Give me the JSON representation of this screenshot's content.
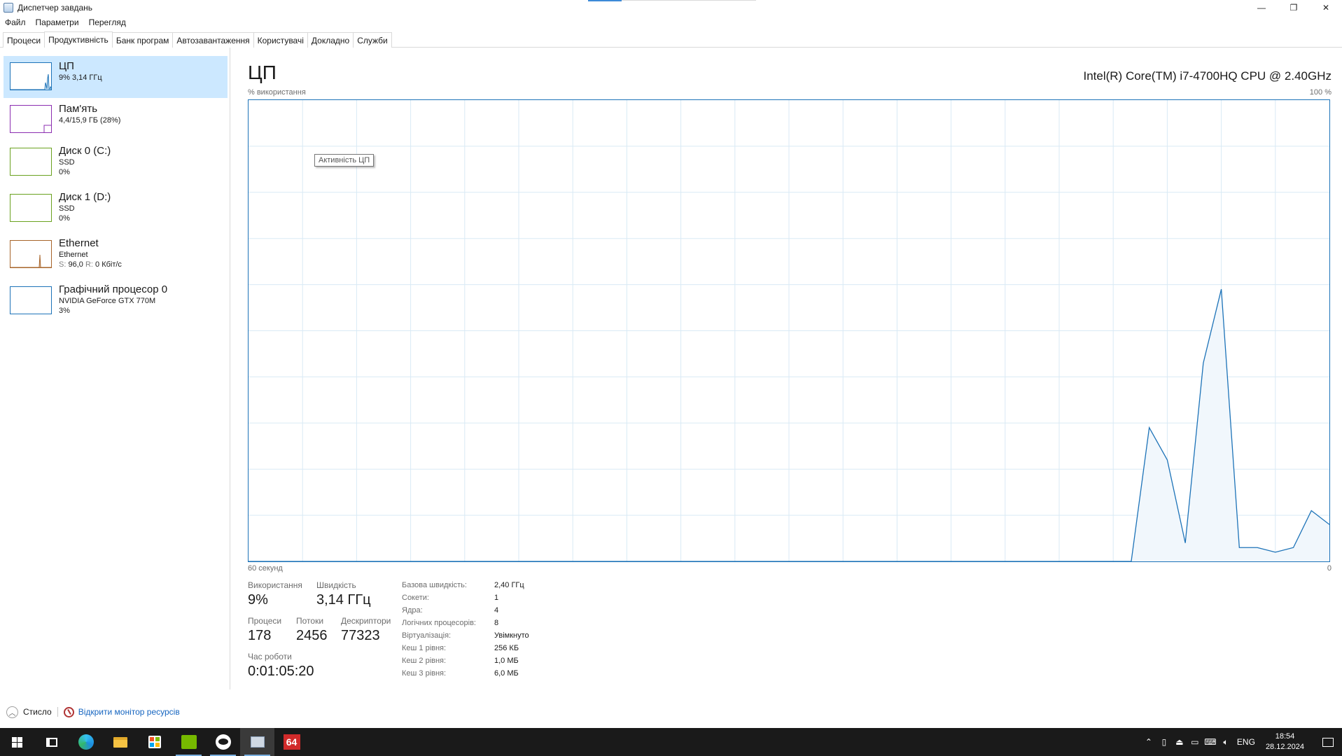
{
  "window": {
    "title": "Диспетчер завдань",
    "controls": {
      "minimize": "—",
      "restore": "❐",
      "close": "✕"
    }
  },
  "menu": [
    "Файл",
    "Параметри",
    "Перегляд"
  ],
  "tabs": [
    {
      "label": "Процеси",
      "active": false
    },
    {
      "label": "Продуктивність",
      "active": true
    },
    {
      "label": "Банк програм",
      "active": false
    },
    {
      "label": "Автозавантаження",
      "active": false
    },
    {
      "label": "Користувачі",
      "active": false
    },
    {
      "label": "Докладно",
      "active": false
    },
    {
      "label": "Служби",
      "active": false
    }
  ],
  "sidebar": {
    "cpu": {
      "name": "ЦП",
      "line1": "9% 3,14 ГГц"
    },
    "memory": {
      "name": "Пам'ять",
      "line1": "4,4/15,9 ГБ (28%)"
    },
    "disk0": {
      "name": "Диск 0 (C:)",
      "line1": "SSD",
      "line2": "0%"
    },
    "disk1": {
      "name": "Диск 1 (D:)",
      "line1": "SSD",
      "line2": "0%"
    },
    "ethernet": {
      "name": "Ethernet",
      "line1": "Ethernet",
      "send_label": "S:",
      "send_value": "96,0",
      "recv_label": "R:",
      "recv_value": "0 Кбіт/с"
    },
    "gpu": {
      "name": "Графічний процесор 0",
      "line1": "NVIDIA GeForce GTX 770M",
      "line2": "3%"
    }
  },
  "main": {
    "title": "ЦП",
    "cpu_model": "Intel(R) Core(TM) i7-4700HQ CPU @ 2.40GHz",
    "y_label": "% використання",
    "y_max_label": "100 %",
    "x_left_label": "60 секунд",
    "x_right_label": "0",
    "tooltip": "Активність ЦП"
  },
  "chart_data": {
    "type": "area",
    "xlabel": "60 секунд",
    "ylabel": "% використання",
    "ylim": [
      0,
      100
    ],
    "xlim": [
      60,
      0
    ],
    "grid": true,
    "color": "#1d73b8",
    "x": [
      60,
      11,
      10,
      9,
      8,
      7,
      6,
      5,
      4,
      3,
      2,
      1,
      0
    ],
    "values": [
      0,
      0,
      29,
      22,
      4,
      43,
      59,
      3,
      3,
      2,
      3,
      11,
      8
    ]
  },
  "stats": {
    "usage": {
      "label": "Використання",
      "value": "9%"
    },
    "speed": {
      "label": "Швидкість",
      "value": "3,14 ГГц"
    },
    "processes": {
      "label": "Процеси",
      "value": "178"
    },
    "threads": {
      "label": "Потоки",
      "value": "2456"
    },
    "handles": {
      "label": "Дескриптори",
      "value": "77323"
    },
    "uptime": {
      "label": "Час роботи",
      "value": "0:01:05:20"
    }
  },
  "specs": [
    {
      "label": "Базова швидкість:",
      "value": "2,40 ГГц"
    },
    {
      "label": "Сокети:",
      "value": "1"
    },
    {
      "label": "Ядра:",
      "value": "4"
    },
    {
      "label": "Логічних процесорів:",
      "value": "8"
    },
    {
      "label": "Віртуалізація:",
      "value": "Увімкнуто"
    },
    {
      "label": "Кеш 1 рівня:",
      "value": "256 КБ"
    },
    {
      "label": "Кеш 2 рівня:",
      "value": "1,0 МБ"
    },
    {
      "label": "Кеш 3 рівня:",
      "value": "6,0 МБ"
    }
  ],
  "footer": {
    "fewer_details": "Стисло",
    "resource_monitor": "Відкрити монітор ресурсів"
  },
  "taskbar": {
    "language": "ENG",
    "time": "18:54",
    "date": "28.12.2024",
    "pinned_badge": "64"
  }
}
